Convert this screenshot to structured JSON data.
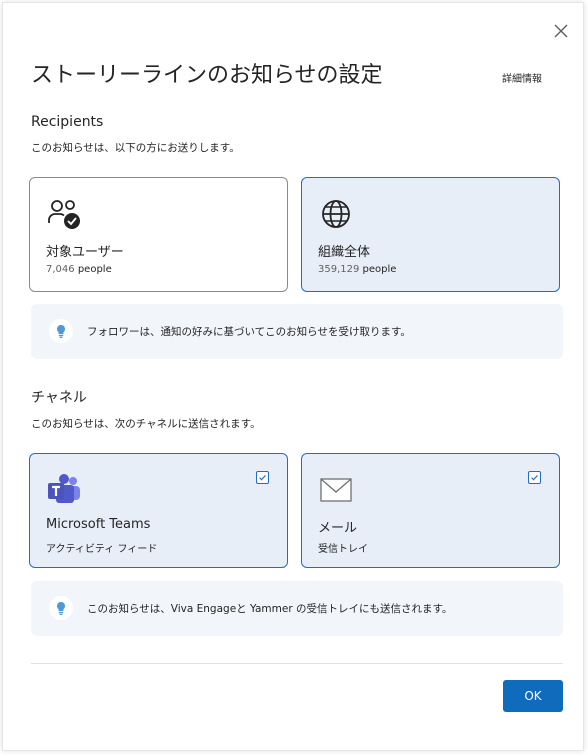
{
  "dialog": {
    "title": "ストーリーラインのお知らせの設定",
    "details_link": "詳細情報",
    "close_label": "×"
  },
  "recipients": {
    "heading": "Recipients",
    "description": "このお知らせは、以下の方にお送りします。",
    "options": [
      {
        "title": "対象ユーザー",
        "count": "7,046",
        "unit": "people",
        "icon": "people-check-icon",
        "selected": false
      },
      {
        "title": "組織全体",
        "count": "359,129",
        "unit": "people",
        "icon": "globe-icon",
        "selected": true
      }
    ],
    "info": "フォロワーは、通知の好みに基づいてこのお知らせを受け取ります。"
  },
  "channels": {
    "heading": "チャネル",
    "description": "このお知らせは、次のチャネルに送信されます。",
    "options": [
      {
        "title": "Microsoft Teams",
        "subtitle": "アクティビティ フィード",
        "icon": "teams-icon",
        "checked": true
      },
      {
        "title": "メール",
        "subtitle": "受信トレイ",
        "icon": "mail-icon",
        "checked": true
      }
    ],
    "info": "このお知らせは、Viva Engageと Yammer の受信トレイにも送信されます。"
  },
  "footer": {
    "ok_label": "OK"
  },
  "colors": {
    "accent": "#0f6cbd",
    "selected_bg": "#e8eef8",
    "info_bg": "#f2f6fb"
  }
}
